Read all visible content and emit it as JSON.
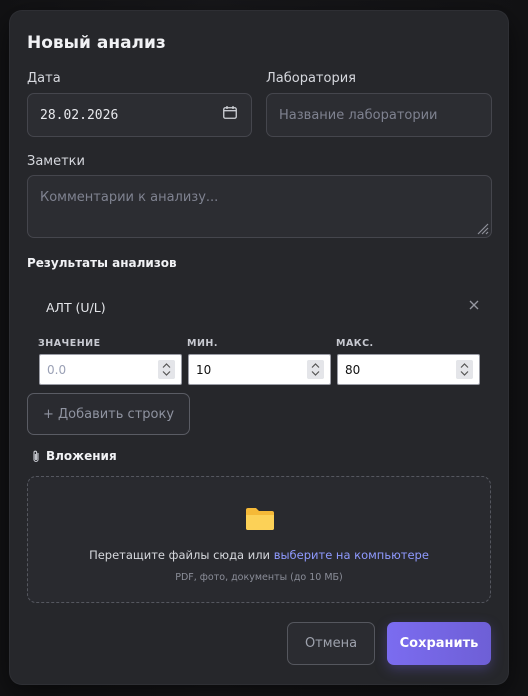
{
  "modal": {
    "title": "Новый анализ",
    "date": {
      "label": "Дата",
      "value": "28.02.2026"
    },
    "lab": {
      "label": "Лаборатория",
      "placeholder": "Название лаборатории"
    },
    "notes": {
      "label": "Заметки",
      "placeholder": "Комментарии к анализу..."
    },
    "results": {
      "heading": "Результаты анализов",
      "rows": [
        {
          "name": "АЛТ (U/L)",
          "value_label": "ЗНАЧЕНИЕ",
          "value_placeholder": "0.0",
          "min_label": "МИН.",
          "min": "10",
          "max_label": "МАКС.",
          "max": "80"
        }
      ],
      "add_row_label": "+ Добавить строку"
    },
    "attachments": {
      "heading": "Вложения",
      "drop_text": "Перетащите файлы сюда или",
      "drop_link": "выберите на компьютере",
      "drop_hint": "PDF, фото, документы (до 10 МБ)"
    },
    "buttons": {
      "cancel": "Отмена",
      "save": "Сохранить"
    }
  },
  "colors": {
    "accent": "#7b6cf0",
    "surface": "#26272b",
    "link": "#8f9aff"
  },
  "icons": [
    "calendar-icon",
    "close-icon",
    "paperclip-icon",
    "folder-icon",
    "resize-grip-icon",
    "spinner-icon"
  ]
}
